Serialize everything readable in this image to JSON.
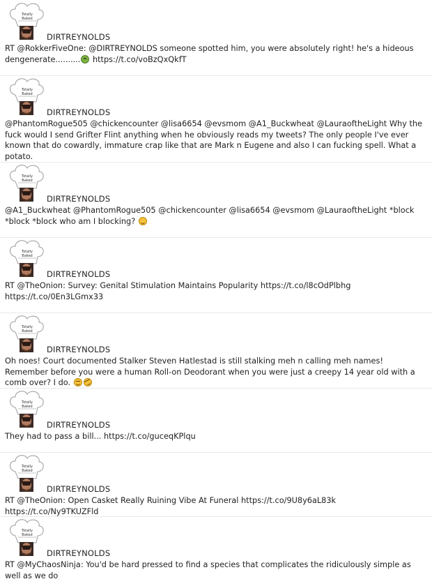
{
  "feed": {
    "tweets": [
      {
        "username": "DIRTREYNOLDS",
        "text": "RT @RokkerFiveOne: @DIRTREYNOLDS someone spotted him, you were absolutely right! he's a hideous dengenerate..........",
        "emoji": "nauseated-face-emoji",
        "text_after": " https://t.co/voBzQxQkfT"
      },
      {
        "username": "DIRTREYNOLDS",
        "text": "@PhantomRogue505 @chickencounter @lisa6654 @evsmom @A1_Buckwheat @LauraoftheLight Why the fuck would I send Grifter Flint anything when he obviously reads my tweets? The only people I've ever known that do cowardly, immature crap like that are Mark n Eugene and also I can fucking spell. What a potato."
      },
      {
        "username": "DIRTREYNOLDS",
        "text": "@A1_Buckwheat @PhantomRogue505 @chickencounter @lisa6654 @evsmom @LauraoftheLight *block *block *block who am I blocking?",
        "emoji": "smirking-face-emoji"
      },
      {
        "username": "DIRTREYNOLDS",
        "text": "RT @TheOnion: Survey: Genital Stimulation Maintains Popularity https://t.co/l8cOdPlbhg https://t.co/0En3LGmx33"
      },
      {
        "username": "DIRTREYNOLDS",
        "text": "Oh noes! Court documented Stalker Steven Hatlestad is still stalking meh n calling meh names! Remember before you were a human Roll-on Deodorant when you were just a creepy 14 year old with a comb over? I do.",
        "emoji": "unamused-face-emoji",
        "emoji2": "rolling-on-floor-laughing-emoji"
      },
      {
        "username": "DIRTREYNOLDS",
        "text": "They had to pass a bill... https://t.co/guceqKPlqu"
      },
      {
        "username": "DIRTREYNOLDS",
        "text": "RT @TheOnion: Open Casket Really Ruining Vibe At Funeral https://t.co/9U8y6aL83k https://t.co/Ny9TKUZFld"
      },
      {
        "username": "DIRTREYNOLDS",
        "text": "RT @MyChaosNinja: You'd be hard pressed to find a species that complicates the ridiculously simple as well as we do"
      }
    ],
    "avatar_caption_line1": "Totally",
    "avatar_caption_line2": "Baked",
    "avatar_icon": "chef-hat-avatar-icon"
  },
  "colors": {
    "text": "#222222",
    "divider": "#e9e9e9",
    "hat": "#ffffff"
  }
}
